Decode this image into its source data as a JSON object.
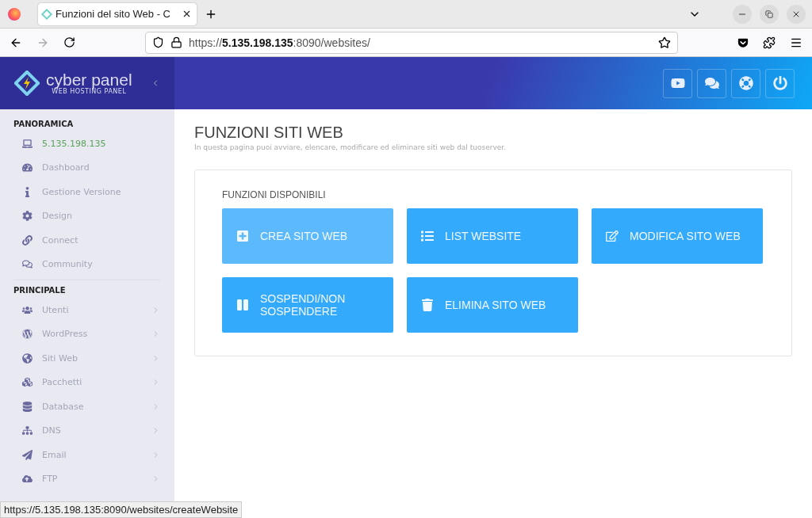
{
  "browser": {
    "tab_title": "Funzioni del sito Web - C",
    "url": "https://**5.135.198.135**:8090/websites/",
    "status_url": "https://5.135.198.135:8090/websites/createWebsite"
  },
  "brand": {
    "name": "cyber panel",
    "tagline": "WEB HOSTING PANEL"
  },
  "sidebar": [
    {
      "title": "PANORAMICA",
      "items": [
        {
          "label": "5.135.198.135",
          "selected": true,
          "submenu": false
        },
        {
          "label": "Dashboard",
          "selected": false,
          "submenu": false
        },
        {
          "label": "Gestione Versione",
          "selected": false,
          "submenu": false
        },
        {
          "label": "Design",
          "selected": false,
          "submenu": false
        },
        {
          "label": "Connect",
          "selected": false,
          "submenu": false
        },
        {
          "label": "Community",
          "selected": false,
          "submenu": false
        }
      ]
    },
    {
      "title": "PRINCIPALE",
      "items": [
        {
          "label": "Utenti",
          "selected": false,
          "submenu": true
        },
        {
          "label": "WordPress",
          "selected": false,
          "submenu": true
        },
        {
          "label": "Siti Web",
          "selected": false,
          "submenu": true
        },
        {
          "label": "Pacchetti",
          "selected": false,
          "submenu": true
        },
        {
          "label": "Database",
          "selected": false,
          "submenu": true
        },
        {
          "label": "DNS",
          "selected": false,
          "submenu": true
        },
        {
          "label": "Email",
          "selected": false,
          "submenu": true
        },
        {
          "label": "FTP",
          "selected": false,
          "submenu": true
        }
      ]
    }
  ],
  "page": {
    "title": "FUNZIONI SITI WEB",
    "subtitle": "In questa pagina puoi avviare, elencare, modificare ed eliminare siti web dal tuoserver."
  },
  "panel": {
    "heading": "FUNZIONI DISPONIBILI",
    "functions": [
      {
        "label": "CREA SITO WEB",
        "highlighted": true
      },
      {
        "label": "LIST WEBSITE",
        "highlighted": false
      },
      {
        "label": "MODIFICA SITO WEB",
        "highlighted": false
      },
      {
        "label": "SOSPENDI/NON SOSPENDERE",
        "highlighted": false
      },
      {
        "label": "ELIMINA SITO WEB",
        "highlighted": false
      }
    ]
  }
}
